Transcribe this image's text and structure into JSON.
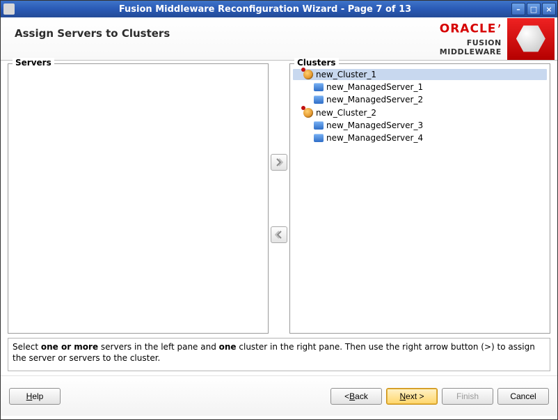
{
  "window": {
    "title": "Fusion Middleware Reconfiguration Wizard - Page 7 of 13"
  },
  "brand": {
    "name": "ORACLE",
    "product": "FUSION MIDDLEWARE"
  },
  "header": {
    "heading": "Assign Servers to Clusters"
  },
  "panes": {
    "left_title": "Servers",
    "right_title": "Clusters"
  },
  "clusters": [
    {
      "name": "new_Cluster_1",
      "selected": true,
      "servers": [
        {
          "name": "new_ManagedServer_1"
        },
        {
          "name": "new_ManagedServer_2"
        }
      ]
    },
    {
      "name": "new_Cluster_2",
      "selected": false,
      "servers": [
        {
          "name": "new_ManagedServer_3"
        },
        {
          "name": "new_ManagedServer_4"
        }
      ]
    }
  ],
  "instruction": {
    "pre": "Select ",
    "b1": "one or more",
    "mid1": " servers in the left pane and ",
    "b2": "one",
    "mid2": " cluster in the right pane. Then use the right arrow button (>) to assign the server or servers to the cluster."
  },
  "buttons": {
    "help": "Help",
    "back": "< Back",
    "next": "Next >",
    "finish": "Finish",
    "cancel": "Cancel"
  }
}
